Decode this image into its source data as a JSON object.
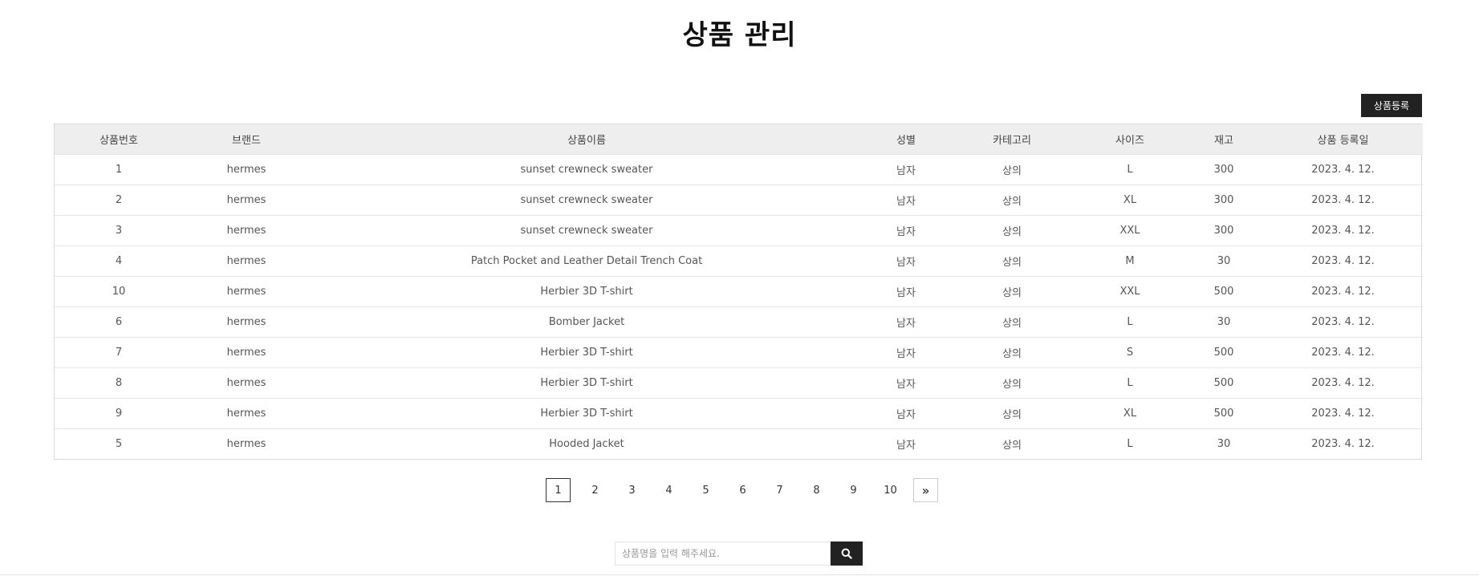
{
  "page": {
    "title": "상품 관리",
    "register_label": "상품등록"
  },
  "table": {
    "headers": [
      "상품번호",
      "브랜드",
      "상품이름",
      "성별",
      "카테고리",
      "사이즈",
      "재고",
      "상품 등록일"
    ],
    "rows": [
      [
        "1",
        "hermes",
        "sunset crewneck sweater",
        "남자",
        "상의",
        "L",
        "300",
        "2023. 4. 12."
      ],
      [
        "2",
        "hermes",
        "sunset crewneck sweater",
        "남자",
        "상의",
        "XL",
        "300",
        "2023. 4. 12."
      ],
      [
        "3",
        "hermes",
        "sunset crewneck sweater",
        "남자",
        "상의",
        "XXL",
        "300",
        "2023. 4. 12."
      ],
      [
        "4",
        "hermes",
        "Patch Pocket and Leather Detail Trench Coat",
        "남자",
        "상의",
        "M",
        "30",
        "2023. 4. 12."
      ],
      [
        "10",
        "hermes",
        "Herbier 3D T-shirt",
        "남자",
        "상의",
        "XXL",
        "500",
        "2023. 4. 12."
      ],
      [
        "6",
        "hermes",
        "Bomber Jacket",
        "남자",
        "상의",
        "L",
        "30",
        "2023. 4. 12."
      ],
      [
        "7",
        "hermes",
        "Herbier 3D T-shirt",
        "남자",
        "상의",
        "S",
        "500",
        "2023. 4. 12."
      ],
      [
        "8",
        "hermes",
        "Herbier 3D T-shirt",
        "남자",
        "상의",
        "L",
        "500",
        "2023. 4. 12."
      ],
      [
        "9",
        "hermes",
        "Herbier 3D T-shirt",
        "남자",
        "상의",
        "XL",
        "500",
        "2023. 4. 12."
      ],
      [
        "5",
        "hermes",
        "Hooded Jacket",
        "남자",
        "상의",
        "L",
        "30",
        "2023. 4. 12."
      ]
    ]
  },
  "pagination": {
    "pages": [
      "1",
      "2",
      "3",
      "4",
      "5",
      "6",
      "7",
      "8",
      "9",
      "10"
    ],
    "current": "1",
    "next_label": "»",
    "next_icon": "double-chevron-right-icon"
  },
  "search": {
    "placeholder": "상품명을 입력 해주세요.",
    "value": "",
    "button_icon": "search-icon"
  },
  "colors": {
    "dark": "#222222",
    "header_bg": "#eeeeee",
    "border": "#d9d9d9"
  }
}
